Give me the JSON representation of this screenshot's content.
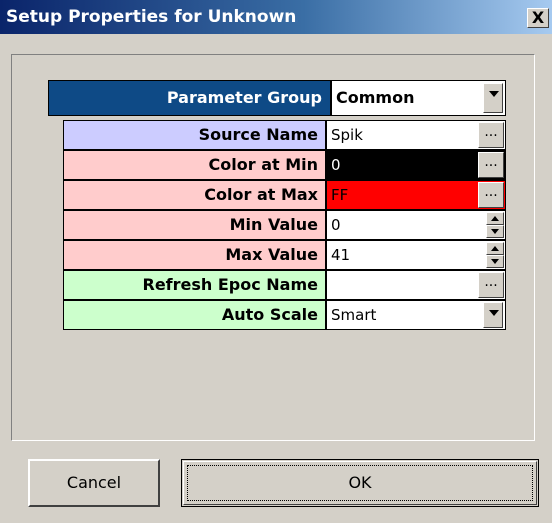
{
  "window": {
    "title": "Setup Properties for Unknown",
    "close_label": "X"
  },
  "parameter_group": {
    "label": "Parameter Group",
    "value": "Common"
  },
  "rows": [
    {
      "label": "Source Name",
      "value": "Spik",
      "label_bg": "#ccccff",
      "value_bg": "#ffffff",
      "value_color": "#000000",
      "control": "ellipsis"
    },
    {
      "label": "Color at Min",
      "value": "0",
      "label_bg": "#ffcccc",
      "value_bg": "#000000",
      "value_color": "#ffffff",
      "control": "ellipsis"
    },
    {
      "label": "Color at Max",
      "value": "FF",
      "label_bg": "#ffcccc",
      "value_bg": "#ff0000",
      "value_color": "#000000",
      "control": "ellipsis"
    },
    {
      "label": "Min Value",
      "value": "0",
      "label_bg": "#ffcccc",
      "value_bg": "#ffffff",
      "value_color": "#000000",
      "control": "spin"
    },
    {
      "label": "Max Value",
      "value": "41",
      "label_bg": "#ffcccc",
      "value_bg": "#ffffff",
      "value_color": "#000000",
      "control": "spin"
    },
    {
      "label": "Refresh Epoc Name",
      "value": "",
      "label_bg": "#ccffcc",
      "value_bg": "#ffffff",
      "value_color": "#000000",
      "control": "ellipsis"
    },
    {
      "label": "Auto Scale",
      "value": "Smart",
      "label_bg": "#ccffcc",
      "value_bg": "#ffffff",
      "value_color": "#000000",
      "control": "dropdown"
    }
  ],
  "ellipsis_label": "...",
  "buttons": {
    "cancel": "Cancel",
    "ok": "OK"
  }
}
